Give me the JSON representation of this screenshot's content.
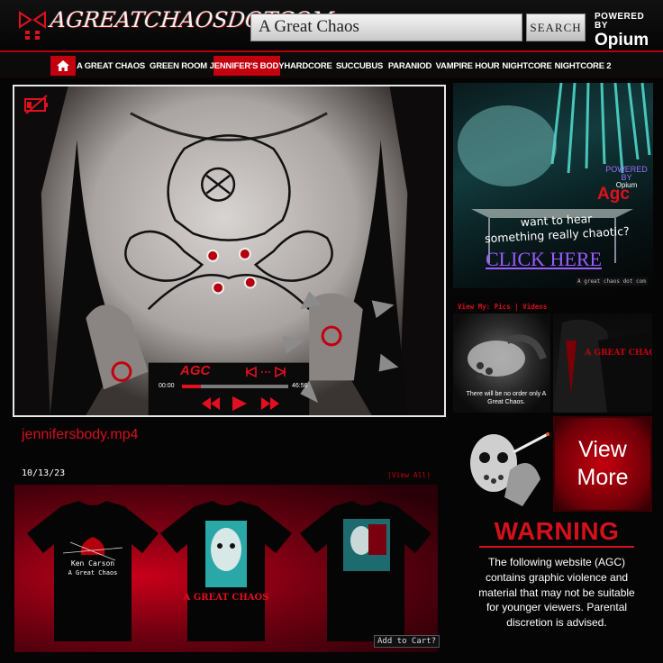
{
  "header": {
    "logo_text": "AGREATCHAOSDOTCOM",
    "search_value": "A Great Chaos",
    "search_button": "SEARCH",
    "powered_small": "POWERED BY",
    "powered_big": "Opium"
  },
  "nav": {
    "items": [
      {
        "label": "A GREAT CHAOS"
      },
      {
        "label": "GREEN ROOM"
      },
      {
        "label": "JENNIFER'S BODY",
        "active": true
      },
      {
        "label": "HARDCORE"
      },
      {
        "label": "SUCCUBUS"
      },
      {
        "label": "PARANIOD"
      },
      {
        "label": "VAMPIRE HOUR"
      },
      {
        "label": "NIGHTCORE"
      },
      {
        "label": "NIGHTCORE 2"
      }
    ]
  },
  "player": {
    "agc_label": "AGC",
    "time_start": "00:00",
    "time_end": "46:56",
    "progress": 0.18,
    "title": "jennifersbody.mp4"
  },
  "merch": {
    "date": "10/13/23",
    "view_all": "(View All)",
    "shirt1_text1": "Ken Carson",
    "shirt1_text2": "A Great Chaos",
    "shirt2_text": "A GREAT CHAOS",
    "add_to_cart": "Add to Cart?"
  },
  "ad": {
    "powered": "POWERED BY",
    "powered_brand": "Opium",
    "agc": "Agc",
    "tagline_1": "want to hear",
    "tagline_2": "something really chaotic?",
    "click_here": "CLICK HERE",
    "url": "A great chaos dot com"
  },
  "gallery": {
    "view_my": "View My: Pics | Videos",
    "pic1_caption": "There will be no order only A Great Chaos.",
    "pic2_text": "A GREAT CHAOS",
    "view_more_1": "View",
    "view_more_2": "More"
  },
  "warning": {
    "title": "WARNING",
    "text": "The following website (AGC) contains graphic violence and material that may not be suitable for younger viewers. Parental discretion is advised."
  },
  "colors": {
    "accent": "#c3000e",
    "ad_purple": "#9a5bff",
    "teal": "#4fd6c8"
  }
}
